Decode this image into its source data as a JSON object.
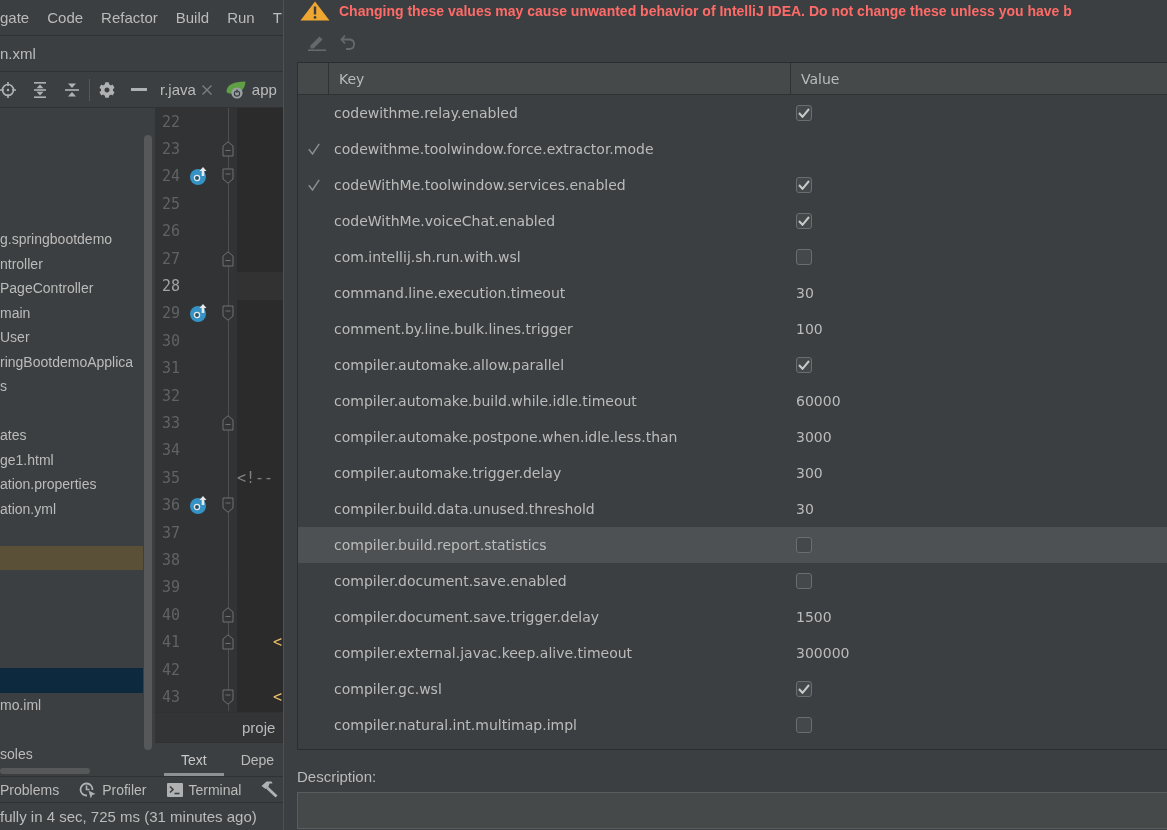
{
  "menu_bar": [
    "gate",
    "Code",
    "Refactor",
    "Build",
    "Run",
    "T"
  ],
  "navigation_bar": {
    "file": "n.xml"
  },
  "project_tree": {
    "rows": [
      {
        "label": "g.springbootdemo",
        "selected": false,
        "highlighted": false
      },
      {
        "label": "ntroller",
        "selected": false,
        "highlighted": false
      },
      {
        "label": "PageController",
        "selected": false,
        "highlighted": false
      },
      {
        "label": "main",
        "selected": false,
        "highlighted": false
      },
      {
        "label": "User",
        "selected": false,
        "highlighted": false
      },
      {
        "label": "ringBootdemoApplica",
        "selected": false,
        "highlighted": false
      },
      {
        "label": "s",
        "selected": false,
        "highlighted": false
      },
      {
        "selected": false,
        "highlighted": false
      },
      {
        "label": "ates",
        "selected": false,
        "highlighted": false
      },
      {
        "label": "ge1.html",
        "selected": false,
        "highlighted": false
      },
      {
        "label": "ation.properties",
        "selected": false,
        "highlighted": false
      },
      {
        "label": "ation.yml",
        "selected": false,
        "highlighted": false
      },
      {
        "selected": false,
        "highlighted": false
      },
      {
        "selected": false,
        "highlighted": true
      },
      {
        "selected": false,
        "highlighted": false
      },
      {
        "selected": false,
        "highlighted": false
      },
      {
        "selected": false,
        "highlighted": false
      },
      {
        "selected": false,
        "highlighted": false
      },
      {
        "selected": true,
        "highlighted": false
      },
      {
        "label": "mo.iml",
        "selected": false,
        "highlighted": false
      },
      {
        "selected": false,
        "highlighted": false
      },
      {
        "label": "soles",
        "selected": false,
        "highlighted": false
      }
    ]
  },
  "editor": {
    "tabs": [
      {
        "label": "r.java",
        "close_button": true
      },
      {
        "label": "app",
        "close_button": false
      }
    ],
    "lines": [
      {
        "number": "22",
        "kind": "plain",
        "current": false,
        "gutter_icon": false
      },
      {
        "number": "23",
        "kind": "closer",
        "current": false,
        "gutter_icon": false
      },
      {
        "number": "24",
        "kind": "opener",
        "current": false,
        "gutter_icon": true
      },
      {
        "number": "25",
        "kind": "plain",
        "current": false,
        "gutter_icon": false
      },
      {
        "number": "26",
        "kind": "plain",
        "current": false,
        "gutter_icon": false
      },
      {
        "number": "27",
        "kind": "closer",
        "current": false,
        "gutter_icon": false
      },
      {
        "number": "28",
        "kind": "plain",
        "current": true,
        "gutter_icon": false
      },
      {
        "number": "29",
        "kind": "opener",
        "current": false,
        "gutter_icon": true
      },
      {
        "number": "30",
        "kind": "plain",
        "current": false,
        "gutter_icon": false
      },
      {
        "number": "31",
        "kind": "plain",
        "current": false,
        "gutter_icon": false
      },
      {
        "number": "32",
        "kind": "plain",
        "current": false,
        "gutter_icon": false
      },
      {
        "number": "33",
        "kind": "closer",
        "current": false,
        "gutter_icon": false
      },
      {
        "number": "34",
        "kind": "plain",
        "current": false,
        "gutter_icon": false
      },
      {
        "number": "35",
        "kind": "plain",
        "current": false,
        "gutter_icon": false,
        "code": {
          "text": "<!--",
          "kind": "comment"
        }
      },
      {
        "number": "36",
        "kind": "opener",
        "current": false,
        "gutter_icon": true
      },
      {
        "number": "37",
        "kind": "plain",
        "current": false,
        "gutter_icon": false
      },
      {
        "number": "38",
        "kind": "plain",
        "current": false,
        "gutter_icon": false
      },
      {
        "number": "39",
        "kind": "plain",
        "current": false,
        "gutter_icon": false
      },
      {
        "number": "40",
        "kind": "closer",
        "current": false,
        "gutter_icon": false
      },
      {
        "number": "41",
        "kind": "closer",
        "current": false,
        "gutter_icon": false,
        "code": {
          "text": "    <",
          "kind": "tag"
        }
      },
      {
        "number": "42",
        "kind": "plain",
        "current": false,
        "gutter_icon": false
      },
      {
        "number": "43",
        "kind": "opener",
        "current": false,
        "gutter_icon": false,
        "code": {
          "text": "    <",
          "kind": "tag"
        }
      }
    ],
    "breadcrumb": "proje",
    "view_tabs": [
      {
        "label": "Text",
        "selected": true
      },
      {
        "label": "Depe",
        "selected": false
      }
    ]
  },
  "registry_dialog": {
    "warning": "Changing these values may cause unwanted behavior of IntelliJ IDEA. Do not change these unless you have b",
    "toolbar": [
      {
        "disabled": true
      },
      {
        "disabled": true
      }
    ],
    "table": {
      "columns": [
        "Key",
        "Value"
      ],
      "rows": [
        {
          "key": "codewithme.relay.enabled",
          "modified": false,
          "selected": false,
          "kind": "checkbox",
          "checked": true
        },
        {
          "key": "codewithme.toolwindow.force.extractor.mode",
          "modified": true,
          "selected": false
        },
        {
          "key": "codeWithMe.toolwindow.services.enabled",
          "modified": true,
          "selected": false,
          "kind": "checkbox",
          "checked": true
        },
        {
          "key": "codeWithMe.voiceChat.enabled",
          "modified": false,
          "selected": false,
          "kind": "checkbox",
          "checked": true
        },
        {
          "key": "com.intellij.sh.run.with.wsl",
          "modified": false,
          "selected": false,
          "kind": "checkbox",
          "checked": false
        },
        {
          "key": "command.line.execution.timeout",
          "modified": false,
          "selected": false,
          "kind": "text",
          "value": "30"
        },
        {
          "key": "comment.by.line.bulk.lines.trigger",
          "modified": false,
          "selected": false,
          "kind": "text",
          "value": "100"
        },
        {
          "key": "compiler.automake.allow.parallel",
          "modified": false,
          "selected": false,
          "kind": "checkbox",
          "checked": true
        },
        {
          "key": "compiler.automake.build.while.idle.timeout",
          "modified": false,
          "selected": false,
          "kind": "text",
          "value": "60000"
        },
        {
          "key": "compiler.automake.postpone.when.idle.less.than",
          "modified": false,
          "selected": false,
          "kind": "text",
          "value": "3000"
        },
        {
          "key": "compiler.automake.trigger.delay",
          "modified": false,
          "selected": false,
          "kind": "text",
          "value": "300"
        },
        {
          "key": "compiler.build.data.unused.threshold",
          "modified": false,
          "selected": false,
          "kind": "text",
          "value": "30"
        },
        {
          "key": "compiler.build.report.statistics",
          "modified": false,
          "selected": true,
          "kind": "checkbox",
          "checked": false
        },
        {
          "key": "compiler.document.save.enabled",
          "modified": false,
          "selected": false,
          "kind": "checkbox",
          "checked": false
        },
        {
          "key": "compiler.document.save.trigger.delay",
          "modified": false,
          "selected": false,
          "kind": "text",
          "value": "1500"
        },
        {
          "key": "compiler.external.javac.keep.alive.timeout",
          "modified": false,
          "selected": false,
          "kind": "text",
          "value": "300000"
        },
        {
          "key": "compiler.gc.wsl",
          "modified": false,
          "selected": false,
          "kind": "checkbox",
          "checked": true
        },
        {
          "key": "compiler.natural.int.multimap.impl",
          "modified": false,
          "selected": false,
          "kind": "checkbox",
          "checked": false
        }
      ]
    },
    "description": {
      "label": "Description:"
    }
  },
  "tool_window_bar": [
    "Problems",
    "Profiler",
    "Terminal"
  ],
  "status_bar": {
    "message": "fully in 4 sec, 725 ms (31 minutes ago)"
  }
}
